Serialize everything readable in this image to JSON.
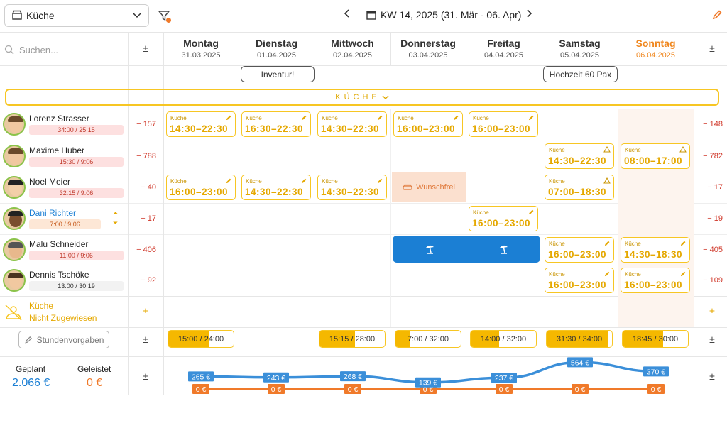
{
  "header": {
    "location": "Küche",
    "week_label": "KW 14, 2025 (31. Mär - 06. Apr)"
  },
  "search": {
    "placeholder": "Suchen..."
  },
  "days": [
    {
      "name": "Montag",
      "date": "31.03.2025"
    },
    {
      "name": "Dienstag",
      "date": "01.04.2025"
    },
    {
      "name": "Mittwoch",
      "date": "02.04.2025"
    },
    {
      "name": "Donnerstag",
      "date": "03.04.2025"
    },
    {
      "name": "Freitag",
      "date": "04.04.2025"
    },
    {
      "name": "Samstag",
      "date": "05.04.2025"
    },
    {
      "name": "Sonntag",
      "date": "06.04.2025"
    }
  ],
  "events": [
    {
      "label": "Inventur!",
      "day": 0
    },
    {
      "label": "Hochzeit 60 Pax",
      "day": 5
    }
  ],
  "department": "KÜCHE",
  "employees": [
    {
      "name": "Lorenz Strasser",
      "hours": "34:00 / 25:15",
      "balance_left": "− 157",
      "balance_right": "− 148"
    },
    {
      "name": "Maxime Huber",
      "hours": "15:30 / 9:06",
      "balance_left": "− 788",
      "balance_right": "− 782"
    },
    {
      "name": "Noel Meier",
      "hours": "32:15 / 9:06",
      "balance_left": "− 40",
      "balance_right": "− 17"
    },
    {
      "name": "Dani Richter",
      "hours": "7:00 / 9:06",
      "balance_left": "− 17",
      "balance_right": "− 19"
    },
    {
      "name": "Malu Schneider",
      "hours": "11:00 / 9:06",
      "balance_left": "− 406",
      "balance_right": "− 405"
    },
    {
      "name": "Dennis Tschöke",
      "hours": "13:00 / 30:19",
      "balance_left": "− 92",
      "balance_right": "− 109"
    }
  ],
  "shift_label": "Küche",
  "shifts": [
    {
      "row": 0,
      "day": 0,
      "time": "14:30–22:30"
    },
    {
      "row": 0,
      "day": 1,
      "time": "16:30–22:30"
    },
    {
      "row": 0,
      "day": 2,
      "time": "14:30–22:30"
    },
    {
      "row": 0,
      "day": 3,
      "time": "16:00–23:00"
    },
    {
      "row": 0,
      "day": 4,
      "time": "16:00–23:00"
    },
    {
      "row": 1,
      "day": 5,
      "time": "14:30–22:30",
      "warn": true
    },
    {
      "row": 1,
      "day": 6,
      "time": "08:00–17:00",
      "warn": true
    },
    {
      "row": 2,
      "day": 0,
      "time": "16:00–23:00"
    },
    {
      "row": 2,
      "day": 1,
      "time": "14:30–22:30"
    },
    {
      "row": 2,
      "day": 2,
      "time": "14:30–22:30"
    },
    {
      "row": 2,
      "day": 5,
      "time": "07:00–18:30",
      "warn": true
    },
    {
      "row": 3,
      "day": 4,
      "time": "16:00–23:00"
    },
    {
      "row": 4,
      "day": 5,
      "time": "16:00–23:00"
    },
    {
      "row": 4,
      "day": 6,
      "time": "14:30–18:30"
    },
    {
      "row": 5,
      "day": 5,
      "time": "16:00–23:00"
    },
    {
      "row": 5,
      "day": 6,
      "time": "16:00–23:00"
    }
  ],
  "wunschfrei": "Wunschfrei",
  "unassigned": {
    "title": "Küche",
    "subtitle": "Nicht Zugewiesen"
  },
  "stundenvorgaben": "Stundenvorgaben",
  "day_totals": [
    {
      "text": "15:00 / 24:00",
      "fill": 0.62
    },
    {
      "text": "",
      "fill": 0
    },
    {
      "text": "15:15 / 28:00",
      "fill": 0.54
    },
    {
      "text": "7:00 / 32:00",
      "fill": 0.22
    },
    {
      "text": "14:00 / 32:00",
      "fill": 0.44
    },
    {
      "text": "31:30 / 34:00",
      "fill": 0.93
    },
    {
      "text": "18:45 / 30:00",
      "fill": 0.62
    }
  ],
  "summary": {
    "planned_label": "Geplant",
    "planned_value": "2.066 €",
    "done_label": "Geleistet",
    "done_value": "0 €"
  },
  "chart_data": {
    "type": "line",
    "categories": [
      "Montag",
      "Dienstag",
      "Mittwoch",
      "Donnerstag",
      "Freitag",
      "Samstag",
      "Sonntag"
    ],
    "series": [
      {
        "values": [
          265,
          243,
          268,
          139,
          237,
          564,
          370
        ],
        "labels": [
          "265 €",
          "243 €",
          "268 €",
          "139 €",
          "237 €",
          "564 €",
          "370 €"
        ],
        "color": "#3b8fd9"
      },
      {
        "values": [
          0,
          0,
          0,
          0,
          0,
          0,
          0
        ],
        "labels": [
          "0 €",
          "0 €",
          "0 €",
          "0 €",
          "0 €",
          "0 €",
          "0 €"
        ],
        "color": "#f07a2a"
      }
    ]
  },
  "colors": {
    "accent": "#f7c623",
    "blue": "#1b7fd4",
    "orange": "#f0871e",
    "negative": "#d0392b"
  }
}
